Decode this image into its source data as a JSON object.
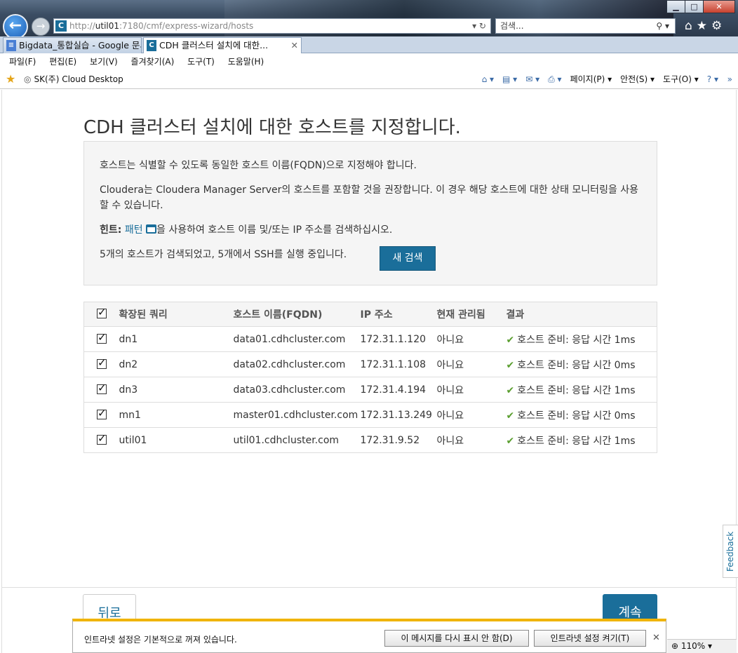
{
  "browser": {
    "window_buttons": {
      "minimize": "▁",
      "maximize": "□",
      "close": "✕"
    },
    "address": {
      "prefix": "http://",
      "host": "util01",
      "rest": ":7180/cmf/express-wizard/hosts",
      "controls": "▾ ↻"
    },
    "search_placeholder": "검색...",
    "tabs": [
      {
        "label": "Bigdata_통합실습 - Google 문서",
        "icon": "≡"
      },
      {
        "label": "CDH 클러스터 설치에 대한...",
        "icon": "C",
        "close": "✕"
      }
    ],
    "menu": [
      "파일(F)",
      "편집(E)",
      "보기(V)",
      "즐겨찾기(A)",
      "도구(T)",
      "도움말(H)"
    ],
    "favorites": {
      "star": "★",
      "link": "SK(주) Cloud Desktop"
    },
    "commands": {
      "page": "페이지(P) ▾",
      "safety": "안전(S) ▾",
      "tools": "도구(O) ▾",
      "help": "? ▾"
    },
    "chevron": "»"
  },
  "page": {
    "title": "CDH 클러스터 설치에 대한 호스트를 지정합니다.",
    "info": {
      "p1": "호스트는 식별할 수 있도록 동일한 호스트 이름(FQDN)으로 지정해야 합니다.",
      "p2": "Cloudera는 Cloudera Manager Server의 호스트를 포함할 것을 권장합니다. 이 경우 해당 호스트에 대한 상태 모니터링을 사용할 수 있습니다.",
      "hint_label": "힌트:",
      "hint_link": "패턴",
      "hint_rest": "을 사용하여 호스트 이름 및/또는 IP 주소를 검색하십시오.",
      "status": "5개의 호스트가 검색되었고, 5개에서 SSH를 실행 중입니다.",
      "new_search": "새 검색"
    },
    "table": {
      "headers": [
        "확장된 쿼리",
        "호스트 이름(FQDN)",
        "IP 주소",
        "현재 관리됨",
        "결과"
      ],
      "rows": [
        {
          "query": "dn1",
          "fqdn": "data01.cdhcluster.com",
          "ip": "172.31.1.120",
          "managed": "아니요",
          "result": "호스트 준비: 응답 시간 1ms"
        },
        {
          "query": "dn2",
          "fqdn": "data02.cdhcluster.com",
          "ip": "172.31.1.108",
          "managed": "아니요",
          "result": "호스트 준비: 응답 시간 0ms"
        },
        {
          "query": "dn3",
          "fqdn": "data03.cdhcluster.com",
          "ip": "172.31.4.194",
          "managed": "아니요",
          "result": "호스트 준비: 응답 시간 1ms"
        },
        {
          "query": "mn1",
          "fqdn": "master01.cdhcluster.com",
          "ip": "172.31.13.249",
          "managed": "아니요",
          "result": "호스트 준비: 응답 시간 0ms"
        },
        {
          "query": "util01",
          "fqdn": "util01.cdhcluster.com",
          "ip": "172.31.9.52",
          "managed": "아니요",
          "result": "호스트 준비: 응답 시간 1ms"
        }
      ]
    },
    "feedback": "Feedback",
    "back": "뒤로",
    "continue": "계속"
  },
  "notification": {
    "message": "인트라넷 설정은 기본적으로 꺼져 있습니다.",
    "dont_show": "이 메시지를 다시 표시 안 함(D)",
    "enable": "인트라넷 설정 켜기(T)",
    "close": "✕"
  },
  "status": {
    "zoom": "110%"
  },
  "colors": {
    "primary": "#1a6e9a",
    "ok": "#5a9e2f",
    "notify_accent": "#f0b400"
  }
}
